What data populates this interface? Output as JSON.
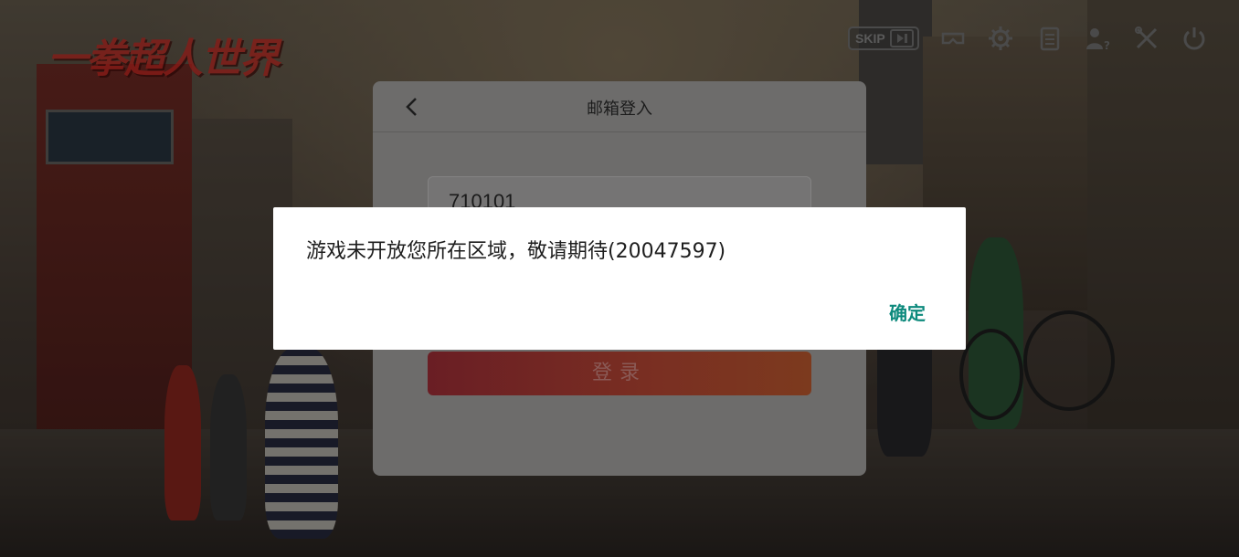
{
  "game": {
    "logo_text": "一拳超人世界"
  },
  "toolbar": {
    "skip_label": "SKIP",
    "icons": [
      "skip-forward-icon",
      "vr-headset-icon",
      "gear-icon",
      "clipboard-icon",
      "user-help-icon",
      "tools-icon",
      "power-icon"
    ],
    "icon_color": "#4a4a4a"
  },
  "login_panel": {
    "title": "邮箱登入",
    "email_value": "710101",
    "login_label": "登录"
  },
  "dialog": {
    "message": "游戏未开放您所在区域，敬请期待(20047597)",
    "ok_label": "确定",
    "accent_color": "#0e8a7d"
  }
}
